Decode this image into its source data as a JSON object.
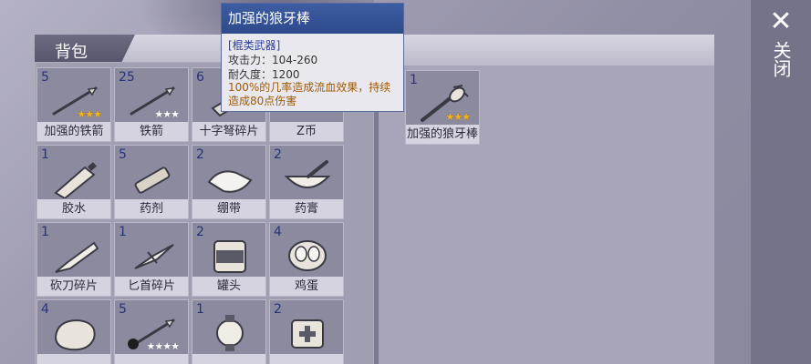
{
  "inventory": {
    "title": "背包",
    "items": [
      {
        "count": "5",
        "name": "加强的铁箭",
        "stars": "★★★",
        "star_color": "gold",
        "icon": "arrow-icon"
      },
      {
        "count": "25",
        "name": "铁箭",
        "stars": "★★★",
        "star_color": "white",
        "icon": "arrow-icon"
      },
      {
        "count": "6",
        "name": "十字弩碎片",
        "stars": "",
        "star_color": "",
        "icon": "crossbow-fragment-icon"
      },
      {
        "count": "",
        "name": "Z币",
        "stars": "",
        "star_color": "",
        "icon": "coin-icon"
      },
      {
        "count": "1",
        "name": "胶水",
        "stars": "",
        "star_color": "",
        "icon": "glue-tube-icon"
      },
      {
        "count": "5",
        "name": "药剂",
        "stars": "",
        "star_color": "",
        "icon": "syringe-icon"
      },
      {
        "count": "2",
        "name": "绷带",
        "stars": "",
        "star_color": "",
        "icon": "bandage-icon"
      },
      {
        "count": "2",
        "name": "药膏",
        "stars": "",
        "star_color": "",
        "icon": "mortar-icon"
      },
      {
        "count": "1",
        "name": "砍刀碎片",
        "stars": "",
        "star_color": "",
        "icon": "machete-fragment-icon"
      },
      {
        "count": "1",
        "name": "匕首碎片",
        "stars": "",
        "star_color": "",
        "icon": "dagger-fragment-icon"
      },
      {
        "count": "2",
        "name": "罐头",
        "stars": "",
        "star_color": "",
        "icon": "can-icon"
      },
      {
        "count": "4",
        "name": "鸡蛋",
        "stars": "",
        "star_color": "",
        "icon": "eggs-icon"
      },
      {
        "count": "4",
        "name": "",
        "stars": "",
        "star_color": "",
        "icon": "meat-icon"
      },
      {
        "count": "5",
        "name": "",
        "stars": "★★★★",
        "star_color": "white",
        "icon": "poison-arrow-icon"
      },
      {
        "count": "1",
        "name": "",
        "stars": "",
        "star_color": "",
        "icon": "watch-icon"
      },
      {
        "count": "2",
        "name": "",
        "stars": "",
        "star_color": "",
        "icon": "first-aid-icon"
      }
    ]
  },
  "equipped": {
    "count": "1",
    "name": "加强的狼牙棒",
    "stars": "★★★",
    "icon": "spiked-club-icon"
  },
  "tooltip": {
    "title": "加强的狼牙棒",
    "type": "[棍类武器]",
    "attack": "攻击力：104-260",
    "durability": "耐久度：1200",
    "effect": "100%的几率造成流血效果，持续造成80点伤害"
  },
  "close": {
    "label": "关闭",
    "icon": "close-icon"
  },
  "colors": {
    "count_text": "#26337a",
    "tooltip_header": "#3d5da3",
    "effect_text": "#a05a00",
    "star_gold": "#f2b21c"
  }
}
